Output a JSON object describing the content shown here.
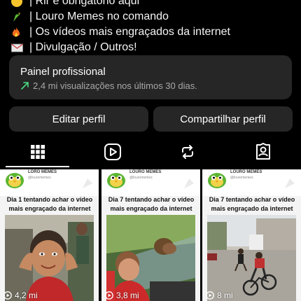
{
  "bio": {
    "lines": [
      {
        "icon": "laughing-face-icon",
        "text": "| Rir é obrigatório aqui"
      },
      {
        "icon": "parrot-icon",
        "text": "| Louro Memes no comando"
      },
      {
        "icon": "fire-icon",
        "text": "| Os vídeos mais engraçados da internet"
      },
      {
        "icon": "envelope-icon",
        "text": "| Divulgação / Outros!"
      }
    ]
  },
  "professional_panel": {
    "title": "Painel profissional",
    "stats": "2,4 mi visualizações nos últimos 30 dias.",
    "trend_color": "#4ade80"
  },
  "actions": {
    "edit_label": "Editar perfil",
    "share_label": "Compartilhar perfil"
  },
  "tabs": [
    {
      "name": "grid-icon",
      "active": true
    },
    {
      "name": "reels-icon",
      "active": false
    },
    {
      "name": "reposts-icon",
      "active": false
    },
    {
      "name": "tagged-icon",
      "active": false
    }
  ],
  "posts": [
    {
      "channel": "LORO MEMES",
      "handle": "@louromemes",
      "caption": "Dia 1 tentando achar o vídeo mais engraçado da internet",
      "views": "4,2 mi"
    },
    {
      "channel": "LOURO MEMES",
      "handle": "@louromemes",
      "caption": "Dia 7 tentando achar o vídeo mais engraçado da internet",
      "views": "3,8 mi"
    },
    {
      "channel": "LOURO MEMES",
      "handle": "@louromemes",
      "caption": "Dia 7 tentando achar o vídeo mais engraçado da internet",
      "views": "8 mi"
    }
  ],
  "colors": {
    "background": "#000000",
    "card": "#262626",
    "text": "#f5f5f5",
    "muted": "#a8a8a8"
  }
}
